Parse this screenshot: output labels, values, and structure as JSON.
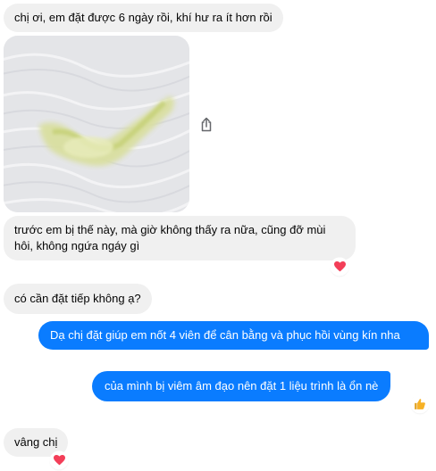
{
  "conversation": {
    "messages": [
      {
        "text": "chị ơi, em đặt được 6 ngày rồi, khí hư ra ít hơn rồi"
      },
      {
        "text": "trước em bị thế này, mà giờ không thấy ra nữa, cũng đỡ mùi hôi, không ngứa ngáy gì"
      },
      {
        "text": "có cần đặt tiếp không ạ?"
      },
      {
        "text": "Dạ chị đặt giúp em nốt 4 viên để cân bằng và phục hồi vùng kín nha"
      },
      {
        "text": "của mình bị viêm âm đạo nên đặt 1 liệu trình là ổn nè"
      },
      {
        "text": "vâng chị"
      }
    ],
    "reactions": {
      "heart": "heart-icon",
      "like": "thumbs-up-icon"
    },
    "colors": {
      "incoming_bubble": "#f0f0f0",
      "outgoing_bubble": "#0a7cff",
      "heart": "#f33e58",
      "like": "#f7b125"
    }
  }
}
